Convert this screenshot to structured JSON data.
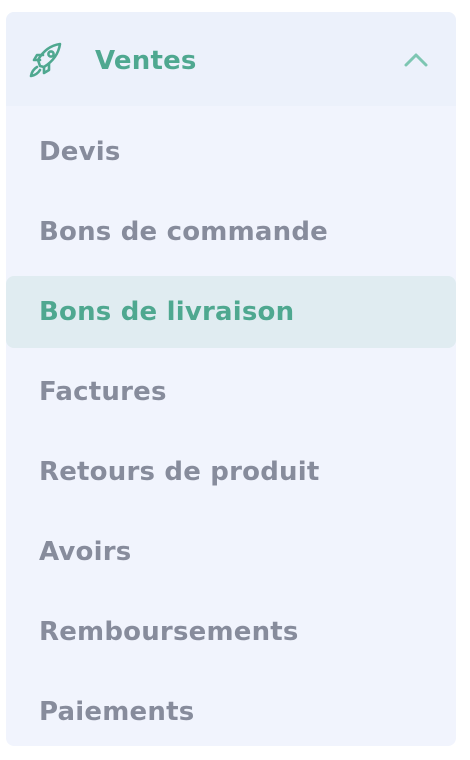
{
  "menu": {
    "header": {
      "label": "Ventes",
      "icon": "rocket-icon",
      "toggle_icon": "chevron-up-icon",
      "expanded": true
    },
    "items": [
      {
        "label": "Devis",
        "active": false
      },
      {
        "label": "Bons de commande",
        "active": false
      },
      {
        "label": "Bons de livraison",
        "active": true
      },
      {
        "label": "Factures",
        "active": false
      },
      {
        "label": "Retours de produit",
        "active": false
      },
      {
        "label": "Avoirs",
        "active": false
      },
      {
        "label": "Remboursements",
        "active": false
      },
      {
        "label": "Paiements",
        "active": false
      }
    ]
  },
  "colors": {
    "accent": "#4fa890",
    "text_muted": "#878c9c",
    "panel_bg": "#f1f4fd",
    "header_bg": "#ecf1fb",
    "active_bg": "#e0ecf1"
  }
}
